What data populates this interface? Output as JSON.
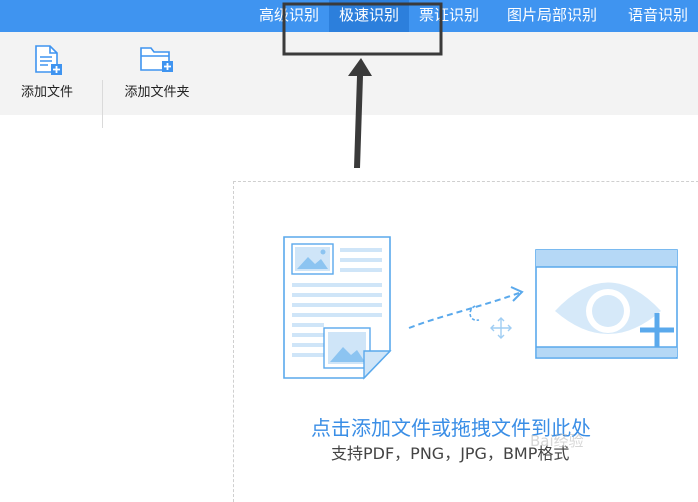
{
  "tabs": [
    {
      "label": "高级识别",
      "active": false
    },
    {
      "label": "极速识别",
      "active": true
    },
    {
      "label": "票证识别",
      "active": false
    },
    {
      "label": "图片局部识别",
      "active": false
    },
    {
      "label": "语音识别",
      "active": false
    }
  ],
  "toolbar": {
    "add_file_label": "添加文件",
    "add_folder_label": "添加文件夹"
  },
  "dropzone": {
    "main_text": "点击添加文件或拖拽文件到此处",
    "sub_text": "支持PDF，PNG，JPG，BMP格式"
  },
  "watermark": "Bai经验",
  "colors": {
    "accent": "#3f94f0",
    "active_tab": "#2c7fdc",
    "illustration": "#5aa9ec",
    "callout": "#3a3a3a"
  }
}
